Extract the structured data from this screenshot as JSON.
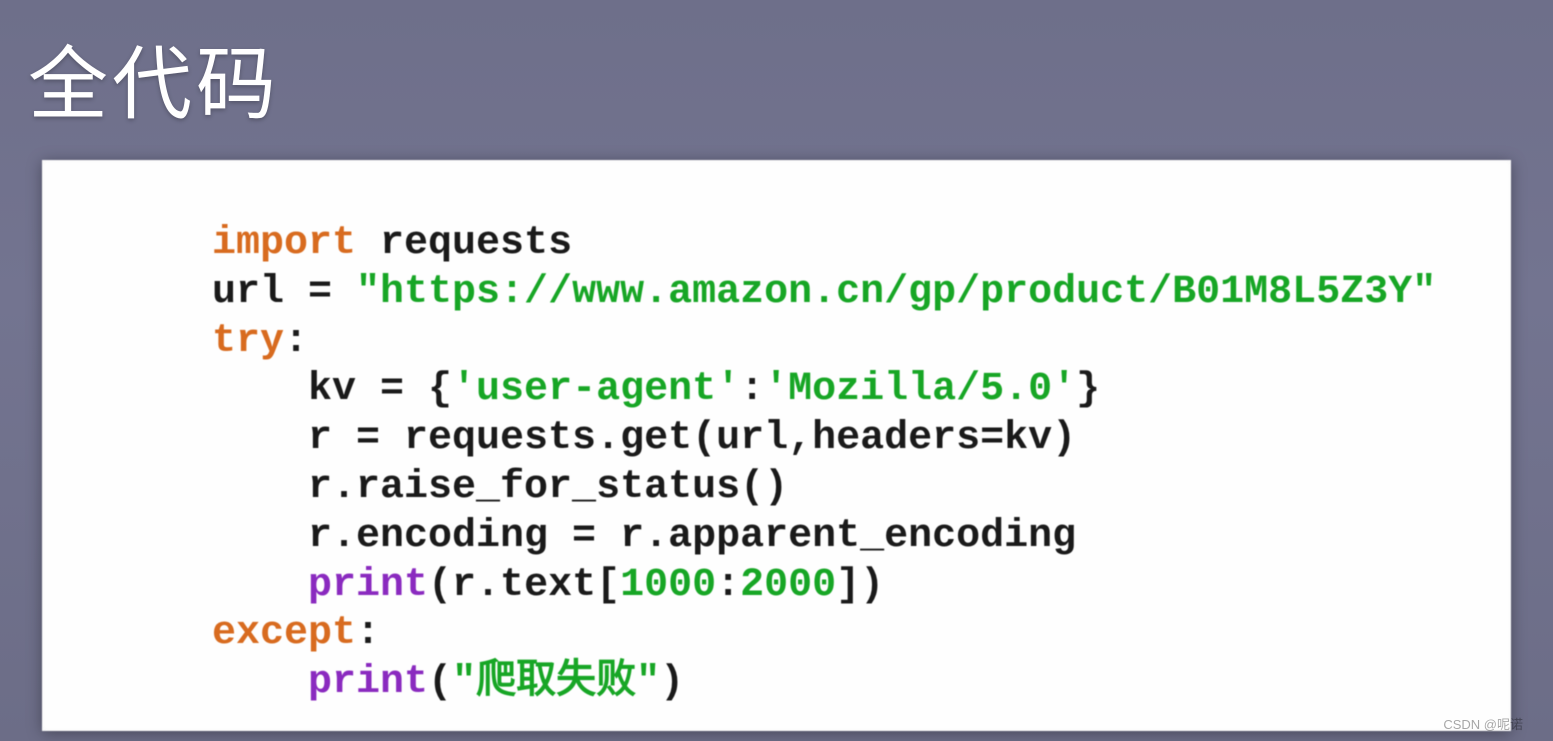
{
  "slide": {
    "title": "全代码"
  },
  "code": {
    "line1": {
      "kw": "import",
      "rest": " requests"
    },
    "line2": {
      "pre": "url = ",
      "str": "\"https://www.amazon.cn/gp/product/B01M8L5Z3Y\""
    },
    "line3": {
      "kw": "try",
      "colon": ":"
    },
    "line4": {
      "indent": "    ",
      "pre": "kv = {",
      "s1": "'user-agent'",
      "mid": ":",
      "s2": "'Mozilla/5.0'",
      "post": "}"
    },
    "line5": {
      "indent": "    ",
      "text": "r = requests.get(url,headers=kv)"
    },
    "line6": {
      "indent": "    ",
      "text": "r.raise_for_status()"
    },
    "line7": {
      "indent": "    ",
      "text": "r.encoding = r.apparent_encoding"
    },
    "line8": {
      "indent": "    ",
      "kw": "print",
      "pre": "(r.text[",
      "n1": "1000",
      "colon": ":",
      "n2": "2000",
      "post": "])"
    },
    "line9": {
      "kw": "except",
      "colon": ":"
    },
    "line10": {
      "indent": "    ",
      "kw": "print",
      "pre": "(",
      "str": "\"爬取失败\"",
      "post": ")"
    }
  },
  "watermark": "CSDN @呢诺"
}
